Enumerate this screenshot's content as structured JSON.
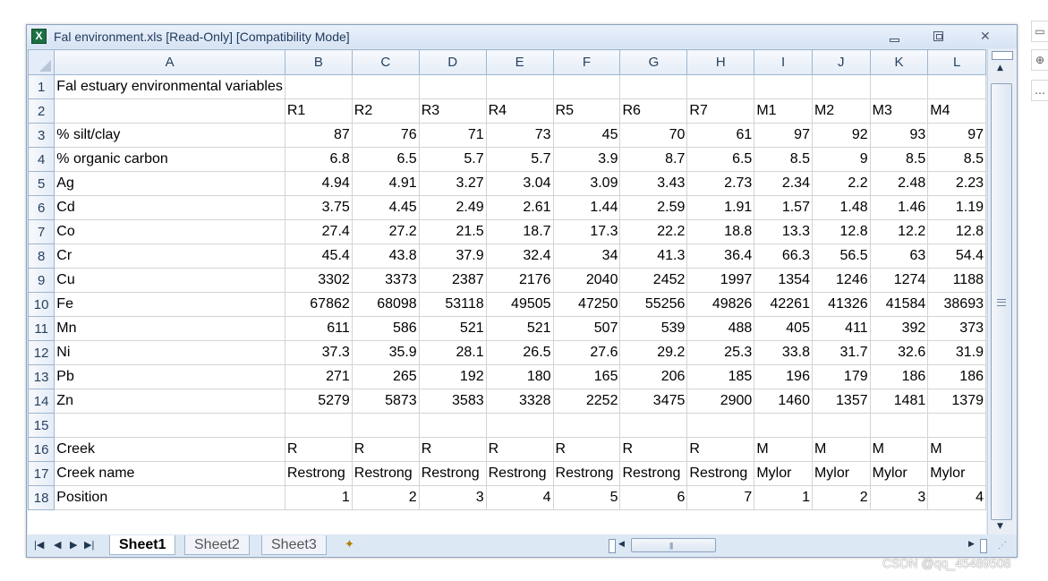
{
  "window": {
    "title": "Fal environment.xls  [Read-Only]  [Compatibility Mode]",
    "icon": "excel-icon"
  },
  "columns": [
    "A",
    "B",
    "C",
    "D",
    "E",
    "F",
    "G",
    "H",
    "I",
    "J",
    "K",
    "L"
  ],
  "rows": [
    {
      "n": "1",
      "cells": [
        "Fal estuary environmental variables",
        "",
        "",
        "",
        "",
        "",
        "",
        "",
        "",
        "",
        "",
        ""
      ]
    },
    {
      "n": "2",
      "cells": [
        "",
        "R1",
        "R2",
        "R3",
        "R4",
        "R5",
        "R6",
        "R7",
        "M1",
        "M2",
        "M3",
        "M4"
      ]
    },
    {
      "n": "3",
      "cells": [
        "% silt/clay",
        "87",
        "76",
        "71",
        "73",
        "45",
        "70",
        "61",
        "97",
        "92",
        "93",
        "97"
      ]
    },
    {
      "n": "4",
      "cells": [
        "% organic carbon",
        "6.8",
        "6.5",
        "5.7",
        "5.7",
        "3.9",
        "8.7",
        "6.5",
        "8.5",
        "9",
        "8.5",
        "8.5"
      ]
    },
    {
      "n": "5",
      "cells": [
        "Ag",
        "4.94",
        "4.91",
        "3.27",
        "3.04",
        "3.09",
        "3.43",
        "2.73",
        "2.34",
        "2.2",
        "2.48",
        "2.23"
      ]
    },
    {
      "n": "6",
      "cells": [
        "Cd",
        "3.75",
        "4.45",
        "2.49",
        "2.61",
        "1.44",
        "2.59",
        "1.91",
        "1.57",
        "1.48",
        "1.46",
        "1.19"
      ]
    },
    {
      "n": "7",
      "cells": [
        "Co",
        "27.4",
        "27.2",
        "21.5",
        "18.7",
        "17.3",
        "22.2",
        "18.8",
        "13.3",
        "12.8",
        "12.2",
        "12.8"
      ]
    },
    {
      "n": "8",
      "cells": [
        "Cr",
        "45.4",
        "43.8",
        "37.9",
        "32.4",
        "34",
        "41.3",
        "36.4",
        "66.3",
        "56.5",
        "63",
        "54.4"
      ]
    },
    {
      "n": "9",
      "cells": [
        "Cu",
        "3302",
        "3373",
        "2387",
        "2176",
        "2040",
        "2452",
        "1997",
        "1354",
        "1246",
        "1274",
        "1188"
      ]
    },
    {
      "n": "10",
      "cells": [
        "Fe",
        "67862",
        "68098",
        "53118",
        "49505",
        "47250",
        "55256",
        "49826",
        "42261",
        "41326",
        "41584",
        "38693"
      ]
    },
    {
      "n": "11",
      "cells": [
        "Mn",
        "611",
        "586",
        "521",
        "521",
        "507",
        "539",
        "488",
        "405",
        "411",
        "392",
        "373"
      ]
    },
    {
      "n": "12",
      "cells": [
        "Ni",
        "37.3",
        "35.9",
        "28.1",
        "26.5",
        "27.6",
        "29.2",
        "25.3",
        "33.8",
        "31.7",
        "32.6",
        "31.9"
      ]
    },
    {
      "n": "13",
      "cells": [
        "Pb",
        "271",
        "265",
        "192",
        "180",
        "165",
        "206",
        "185",
        "196",
        "179",
        "186",
        "186"
      ]
    },
    {
      "n": "14",
      "cells": [
        "Zn",
        "5279",
        "5873",
        "3583",
        "3328",
        "2252",
        "3475",
        "2900",
        "1460",
        "1357",
        "1481",
        "1379"
      ]
    },
    {
      "n": "15",
      "cells": [
        "",
        "",
        "",
        "",
        "",
        "",
        "",
        "",
        "",
        "",
        "",
        ""
      ]
    },
    {
      "n": "16",
      "cells": [
        "Creek",
        "R",
        "R",
        "R",
        "R",
        "R",
        "R",
        "R",
        "M",
        "M",
        "M",
        "M"
      ]
    },
    {
      "n": "17",
      "cells": [
        "Creek name",
        "Restrong",
        "Restrong",
        "Restrong",
        "Restrong",
        "Restrong",
        "Restrong",
        "Restrong",
        "Mylor",
        "Mylor",
        "Mylor",
        "Mylor"
      ]
    },
    {
      "n": "18",
      "cells": [
        "Position",
        "1",
        "2",
        "3",
        "4",
        "5",
        "6",
        "7",
        "1",
        "2",
        "3",
        "4"
      ]
    }
  ],
  "sheet_tabs": [
    "Sheet1",
    "Sheet2",
    "Sheet3"
  ],
  "active_tab": "Sheet1",
  "watermark": "CSDN @qq_45489508"
}
